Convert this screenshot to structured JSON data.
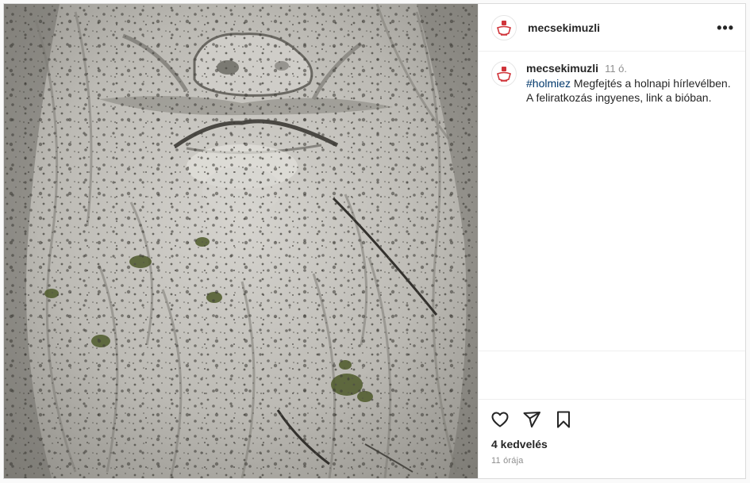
{
  "header": {
    "username": "mecsekimuzli",
    "more_label": "•••",
    "avatar_icon": "mecsekimuzli-logo-icon"
  },
  "caption": {
    "username": "mecsekimuzli",
    "time": "11 ó.",
    "hashtag": "#holmiez",
    "text": " Megfejtés a holnapi hírlevélben. A feliratkozás ingyenes, link a bióban."
  },
  "actions": {
    "like_icon": "heart-icon",
    "share_icon": "paper-plane-icon",
    "save_icon": "bookmark-icon"
  },
  "likes_text": "4 kedvelés",
  "posted_ago": "11 órája",
  "image": {
    "subject": "stone-carved-face-icon",
    "colors": {
      "stone": "#b9b7b1",
      "shadow": "#5f5d57",
      "moss": "#4e5a2a"
    }
  },
  "colors": {
    "hashtag": "#00376b",
    "muted": "#8e8e8e",
    "brand_red": "#d0343a",
    "border": "#dbdbdb"
  }
}
